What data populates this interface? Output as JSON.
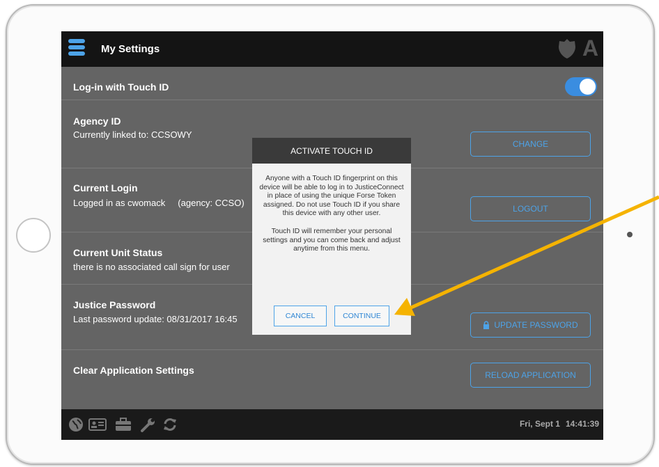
{
  "app": {
    "title": "My Settings",
    "badge_letter": "A"
  },
  "settings": {
    "touch_id": {
      "label": "Log-in with Touch ID",
      "enabled": true
    },
    "agency": {
      "label": "Agency ID",
      "value": "Currently linked to: CCSOWY",
      "button": "CHANGE"
    },
    "login": {
      "label": "Current Login",
      "value": "Logged in as cwomack     (agency: CCSO)",
      "button": "LOGOUT"
    },
    "unit": {
      "label": "Current Unit Status",
      "value": "there is no associated call sign for user"
    },
    "password": {
      "label": "Justice Password",
      "value": "Last password update: 08/31/2017 16:45",
      "button": "UPDATE PASSWORD"
    },
    "clear": {
      "label": "Clear Application Settings",
      "button": "RELOAD APPLICATION"
    }
  },
  "dialog": {
    "title": "ACTIVATE TOUCH ID",
    "paragraph1": "Anyone with a Touch ID fingerprint on this device will be able to log in to JusticeConnect in place of using the unique Forse Token assigned. Do not use Touch ID if you share this device with any other user.",
    "paragraph2": "Touch ID will remember your personal settings and you can come back and adjust anytime from this menu.",
    "cancel": "CANCEL",
    "continue": "CONTINUE"
  },
  "bottombar": {
    "icons": [
      "globe-icon",
      "id-card-icon",
      "briefcase-icon",
      "wrench-icon",
      "refresh-icon"
    ],
    "date": "Fri, Sept 1",
    "time": "14:41:39"
  },
  "colors": {
    "accent": "#4da3e8",
    "annotation_arrow": "#f5b301",
    "overlay": "#646464"
  }
}
